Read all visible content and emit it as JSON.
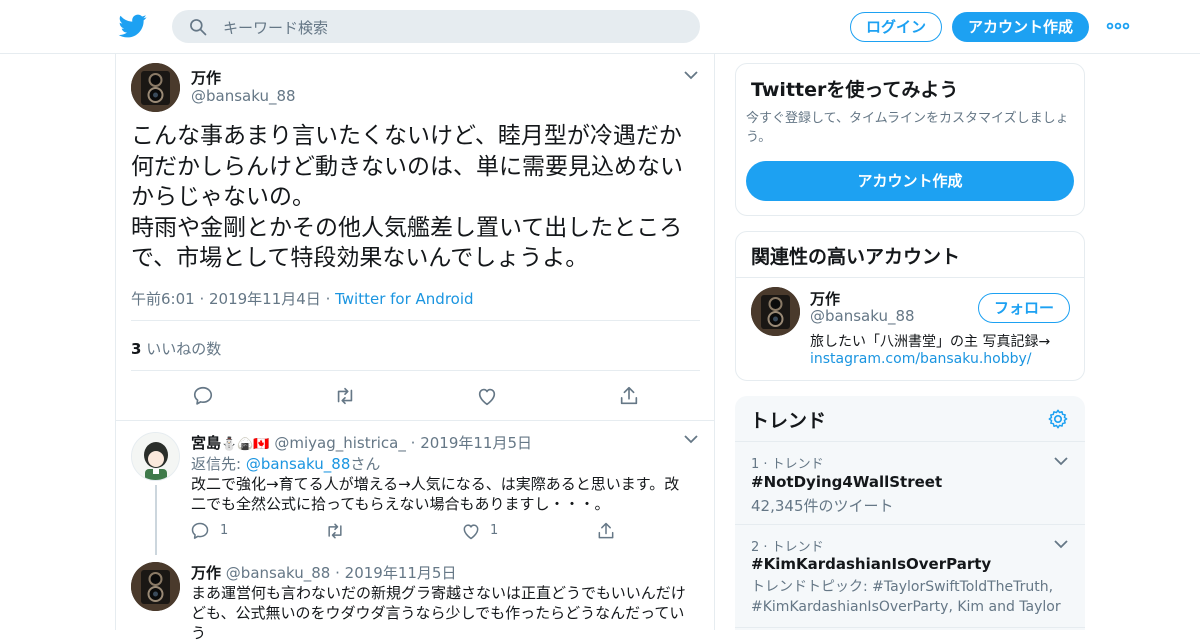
{
  "header": {
    "search_placeholder": "キーワード検索",
    "login_label": "ログイン",
    "signup_label": "アカウント作成"
  },
  "tweet": {
    "author_name": "万作",
    "author_handle": "@bansaku_88",
    "text": "こんな事あまり言いたくないけど、睦月型が冷遇だか\n何だかしらんけど動きないのは、単に需要見込めない\nからじゃないの。\n時雨や金剛とかその他人気艦差し置いて出したところ\nで、市場として特段効果ないんでしょうよ。",
    "timestamp": "午前6:01 · 2019年11月4日",
    "separator": " · ",
    "source": "Twitter for Android",
    "likes_count": "3",
    "likes_label": "いいねの数"
  },
  "replies": [
    {
      "author_name": "宮島",
      "emoji": "⛄🍙🇨🇦",
      "author_handle": "@miyag_histrica_",
      "date": "· 2019年11月5日",
      "reply_to_prefix": "返信先: ",
      "reply_to_handle": "@bansaku_88",
      "reply_to_suffix": "さん",
      "text": "改二で強化→育てる人が増える→人気になる、は実際あると思います。改\n二でも全然公式に拾ってもらえない場合もありますし・・・。",
      "reply_count": "1",
      "like_count": "1"
    },
    {
      "author_name": "万作",
      "author_handle": "@bansaku_88",
      "date": "· 2019年11月5日",
      "text": "まあ運営何も言わないだの新規グラ寄越さないは正直どうでもいいんだけ\nども、公式無いのをウダウダ言うなら少しでも作ったらどうなんだってい\nう"
    }
  ],
  "sidebar": {
    "try_card": {
      "title": "Twitterを使ってみよう",
      "description": "今すぐ登録して、タイムラインをカスタマイズしましょ\nう。",
      "button_label": "アカウント作成"
    },
    "related_card": {
      "title": "関連性の高いアカウント",
      "name": "万作",
      "handle": "@bansaku_88",
      "follow_label": "フォロー",
      "bio": "旅したい「八洲書堂」の主 写真記録→",
      "link": "instagram.com/bansaku.hobby/"
    },
    "trends": {
      "title": "トレンド",
      "items": [
        {
          "rank_label": "1 · トレンド",
          "name": "#NotDying4WallStreet",
          "meta": "42,345件のツイート"
        },
        {
          "rank_label": "2 · トレンド",
          "name": "#KimKardashianIsOverParty",
          "meta": "トレンドトピック: #TaylorSwiftToldTheTruth,\n#KimKardashianIsOverParty, Kim and Taylor"
        }
      ]
    }
  },
  "colors": {
    "accent": "#1da1f2",
    "link": "#1b95e0",
    "secondary_text": "#657786",
    "border": "#e6ecf0"
  }
}
